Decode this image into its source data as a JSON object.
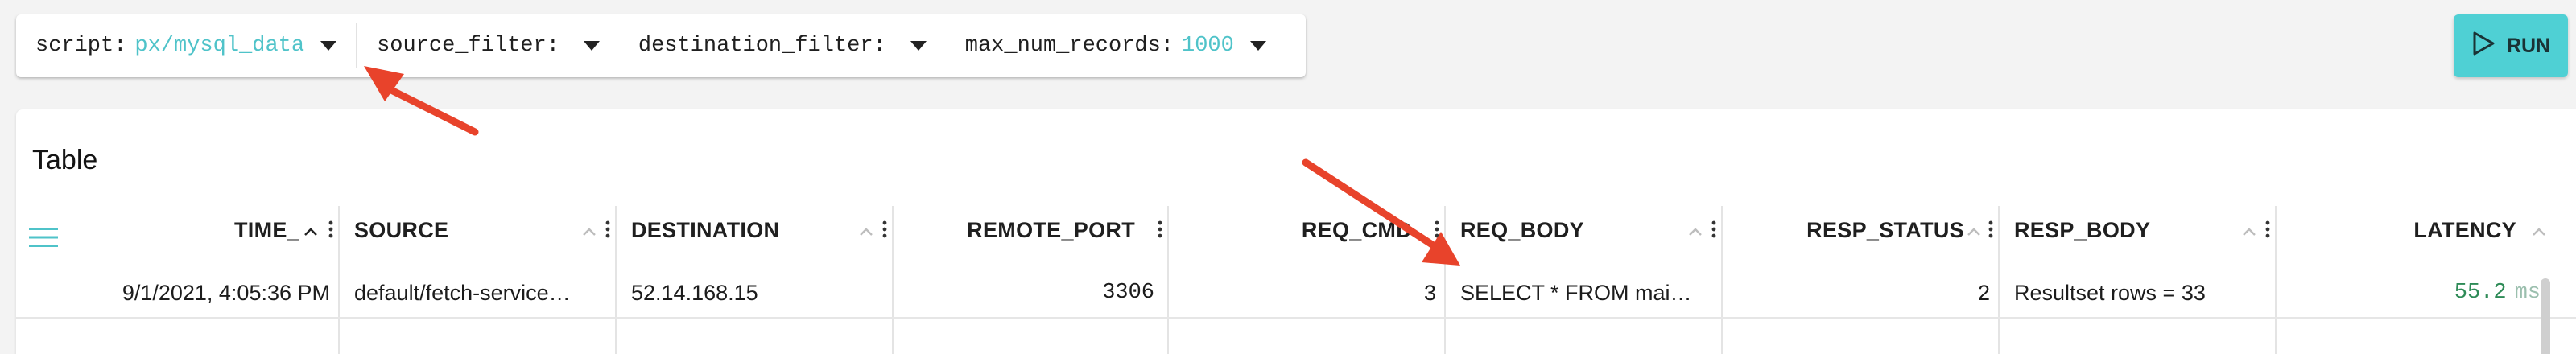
{
  "toolbar": {
    "args": [
      {
        "key": "script:",
        "value": "px/mysql_data"
      },
      {
        "key": "source_filter:",
        "value": ""
      },
      {
        "key": "destination_filter:",
        "value": ""
      },
      {
        "key": "max_num_records:",
        "value": "1000"
      }
    ],
    "run_label": "RUN"
  },
  "table": {
    "title": "Table",
    "columns": [
      "TIME_",
      "SOURCE",
      "DESTINATION",
      "REMOTE_PORT",
      "REQ_CMD",
      "REQ_BODY",
      "RESP_STATUS",
      "RESP_BODY",
      "LATENCY"
    ],
    "rows": [
      {
        "time": "9/1/2021, 4:05:36 PM",
        "source": "default/fetch-service…",
        "destination": "52.14.168.15",
        "remote_port": "3306",
        "req_cmd": "3",
        "req_body": "SELECT * FROM mai…",
        "resp_status": "2",
        "resp_body": "Resultset rows = 33",
        "latency_value": "55.2",
        "latency_unit": "ms"
      }
    ]
  },
  "colors": {
    "accent": "#4fd0d4",
    "value_text": "#4fc3c9",
    "arrow": "#e8432b",
    "latency": "#2e8b57"
  },
  "icons": {
    "dropdown": "caret-down-icon",
    "run": "play-outline-icon",
    "menu": "hamburger-icon",
    "sort": "chevron-up-icon",
    "column_menu": "kebab-icon"
  }
}
